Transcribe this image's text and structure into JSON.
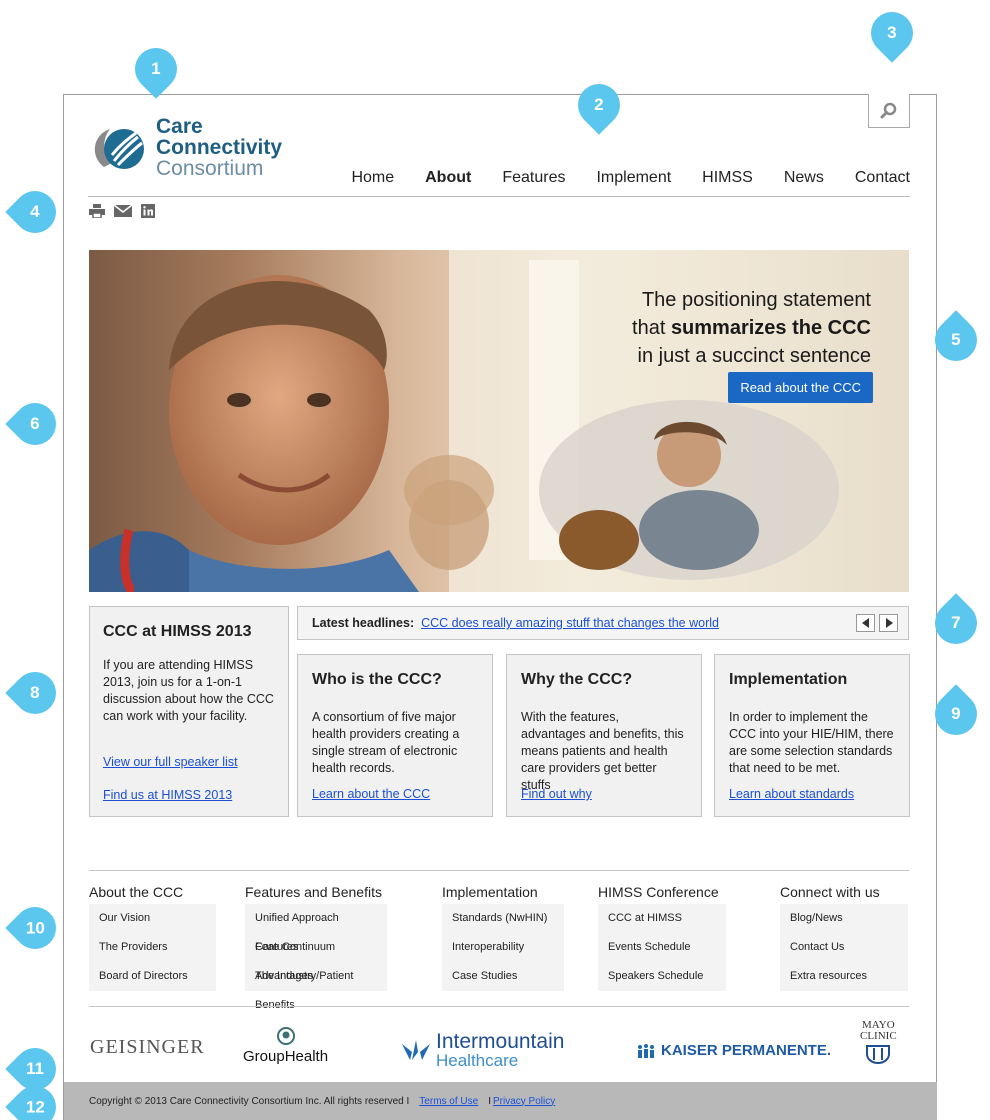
{
  "markers": [
    "1",
    "2",
    "3",
    "4",
    "5",
    "6",
    "7",
    "8",
    "9",
    "10",
    "11",
    "12"
  ],
  "logo": {
    "line1": "Care",
    "line2": "Connectivity",
    "line3": "Consortium"
  },
  "nav": {
    "items": [
      "Home",
      "About",
      "Features",
      "Implement",
      "HIMSS",
      "News",
      "Contact"
    ],
    "active": "About"
  },
  "hero": {
    "line1": "The positioning statement",
    "line2_pre": "that ",
    "line2_bold": "summarizes the CCC",
    "line3": "in just a succinct sentence",
    "button": "Read about the CCC"
  },
  "himss": {
    "title": "CCC at HIMSS 2013",
    "body": "If you are attending HIMSS 2013, join us for a 1-on-1 discussion about how the CCC can work with your facility.",
    "link1": "View our full speaker list",
    "link2": "Find us at HIMSS 2013"
  },
  "headlines": {
    "label": "Latest headlines:",
    "link": "CCC does really amazing stuff that changes the world"
  },
  "cards": [
    {
      "title": "Who is the CCC?",
      "body": "A consortium of five major health providers creating a single stream of electronic health records.",
      "link": "Learn about the CCC"
    },
    {
      "title": "Why the CCC?",
      "body": "With the features, advantages and benefits, this means patients and health care providers get better stuffs",
      "link": "Find out why"
    },
    {
      "title": "Implementation",
      "body": "In order to implement the CCC into your HIE/HIM, there are some selection standards that need to be met.",
      "link": "Learn about standards"
    }
  ],
  "footer": [
    {
      "title": "About the CCC",
      "items": [
        "Our Vision",
        "The Providers",
        "Board of Directors"
      ]
    },
    {
      "title": "Features and Benefits",
      "items": [
        "Unified Approach Features",
        "Care Continuum Advantages",
        "The Industry/Patient Benefits"
      ]
    },
    {
      "title": "Implementation",
      "items": [
        "Standards (NwHIN)",
        "Interoperability",
        "Case Studies"
      ]
    },
    {
      "title": "HIMSS Conference",
      "items": [
        "CCC at HIMSS",
        "Events Schedule",
        "Speakers Schedule"
      ]
    },
    {
      "title": "Connect with us",
      "items": [
        "Blog/News",
        "Contact Us",
        "Extra resources"
      ]
    }
  ],
  "partners": {
    "geisinger": "GEISINGER",
    "grouphealth": "GroupHealth",
    "intermountain1": "Intermountain",
    "intermountain2": "Healthcare",
    "kaiser": "KAISER PERMANENTE.",
    "mayo1": "MAYO",
    "mayo2": "CLINIC"
  },
  "copyright": {
    "text": "Copyright © 2013 Care Connectivity Consortium Inc. All rights reserved   I",
    "terms": "Terms of Use",
    "sep": "I",
    "privacy": "Privacy Policy"
  },
  "colors": {
    "marker": "#5bc6ee",
    "accent": "#1b67c4",
    "link": "#1b4fd6",
    "logo": "#1f5e83"
  }
}
